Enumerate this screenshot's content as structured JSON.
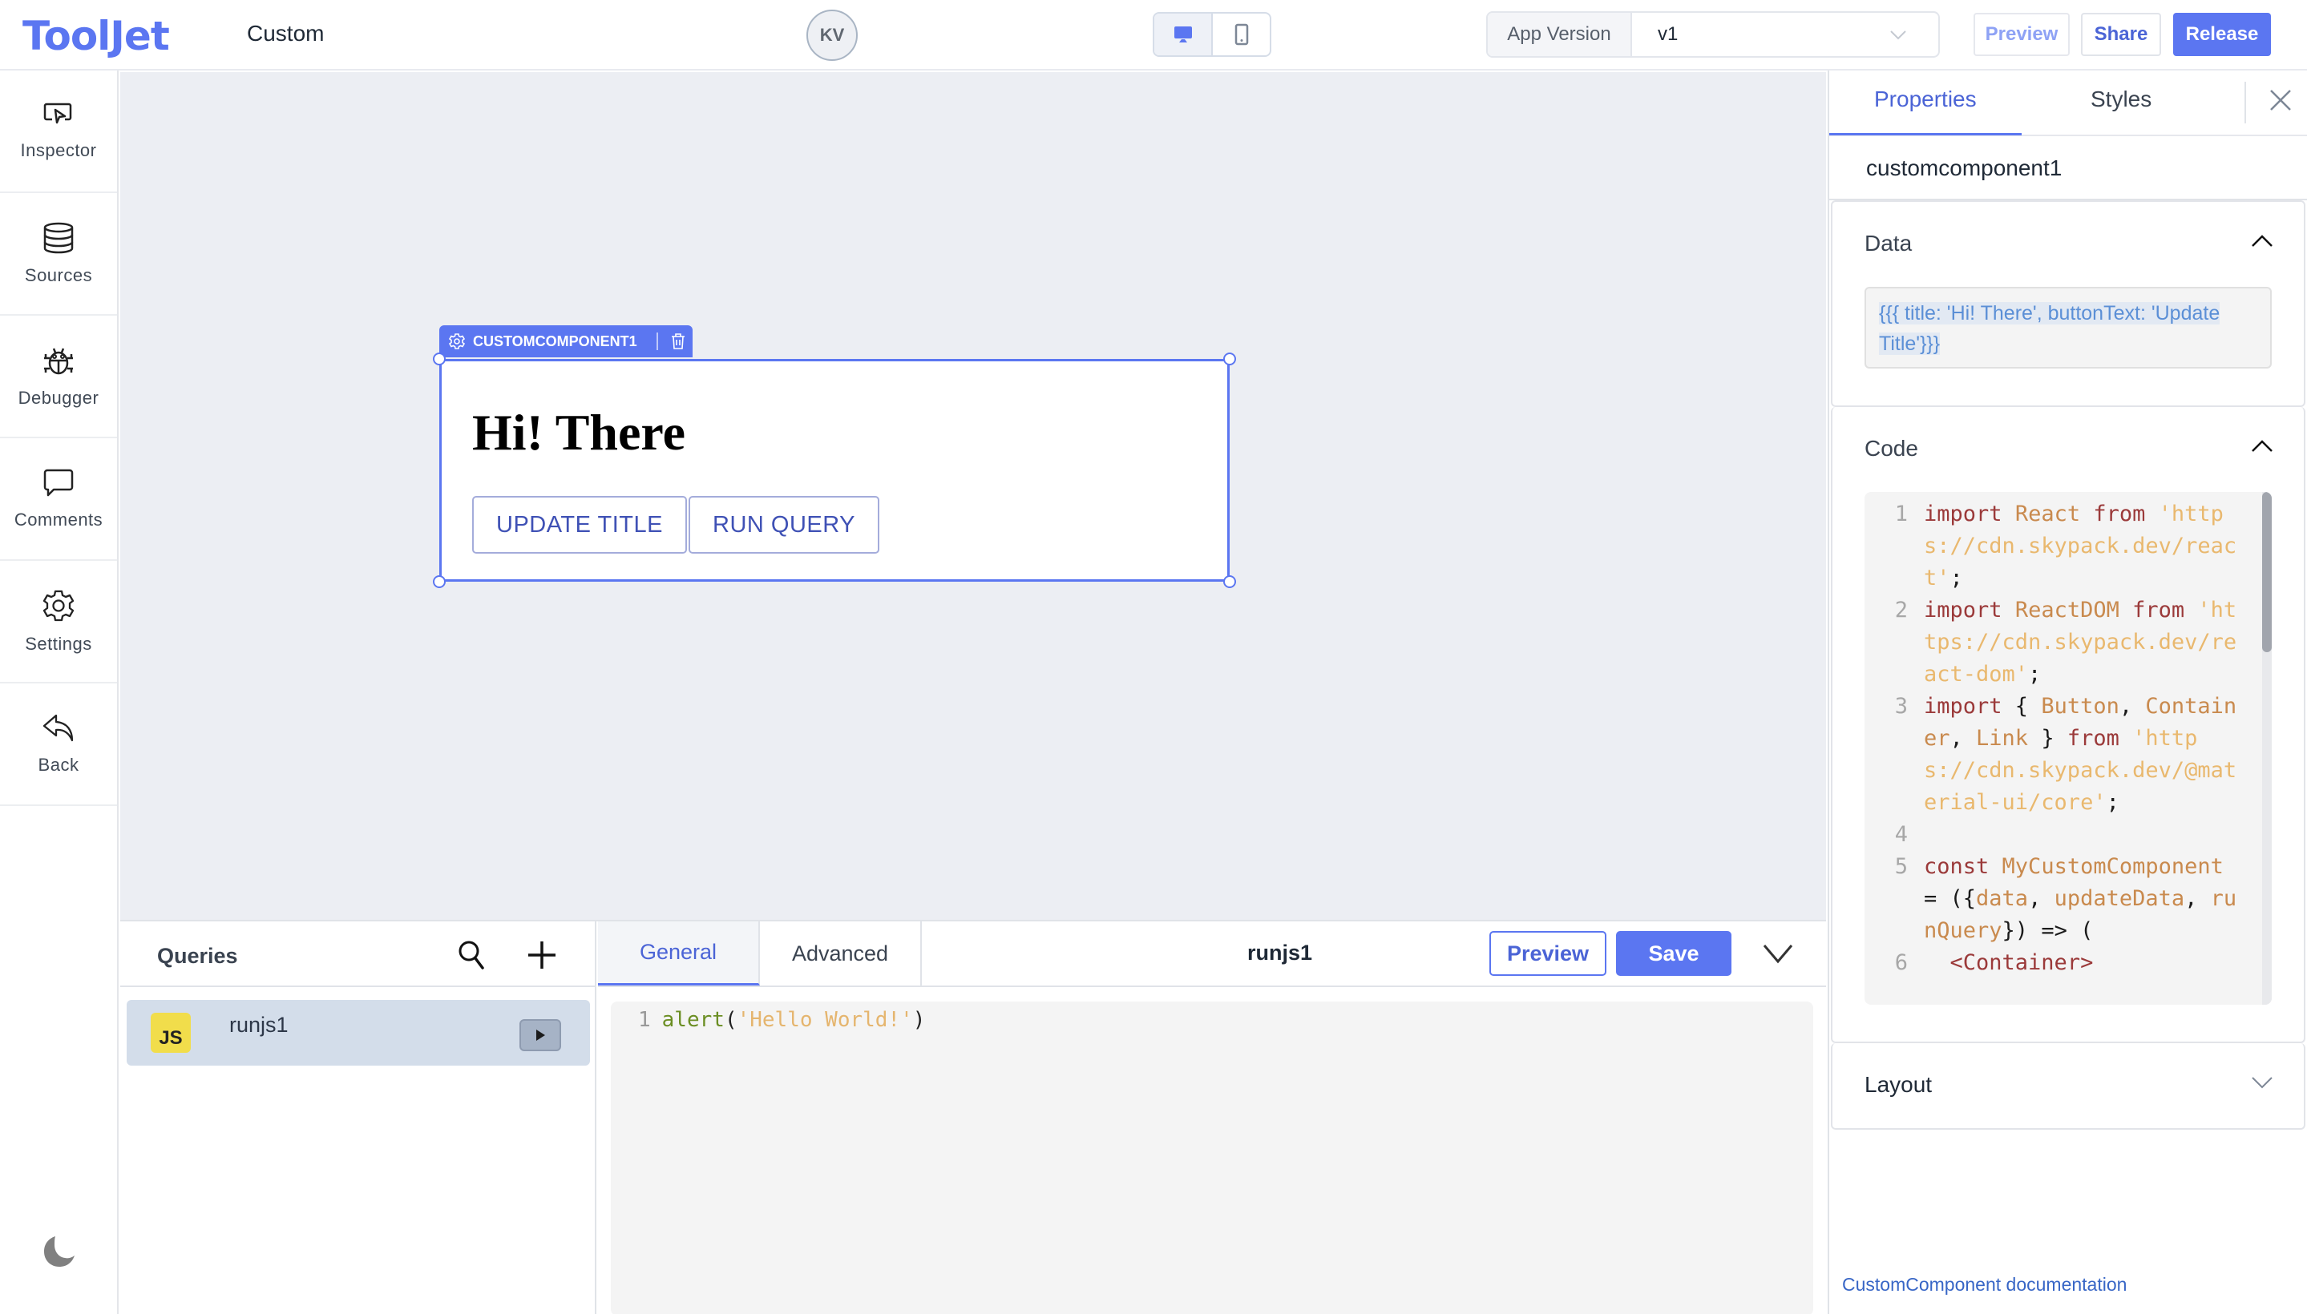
{
  "header": {
    "logo": "ToolJet",
    "app_name": "Custom",
    "avatar_initials": "KV",
    "device_toggle": {
      "active": "desktop",
      "options": [
        "desktop",
        "mobile"
      ]
    },
    "app_version_label": "App Version",
    "app_version_value": "v1",
    "preview_label": "Preview",
    "share_label": "Share",
    "release_label": "Release"
  },
  "sidebar": {
    "items": [
      {
        "label": "Inspector",
        "icon": "inspector-icon"
      },
      {
        "label": "Sources",
        "icon": "database-icon"
      },
      {
        "label": "Debugger",
        "icon": "bug-icon"
      },
      {
        "label": "Comments",
        "icon": "comment-icon"
      },
      {
        "label": "Settings",
        "icon": "gear-icon"
      },
      {
        "label": "Back",
        "icon": "back-arrow-icon"
      }
    ],
    "theme_toggle_icon": "moon-icon"
  },
  "canvas": {
    "component_tag": "CUSTOMCOMPONENT1",
    "component": {
      "title": "Hi! There",
      "buttons": [
        "UPDATE TITLE",
        "RUN QUERY"
      ]
    }
  },
  "queries": {
    "title": "Queries",
    "items": [
      {
        "name": "runjs1",
        "type": "JS"
      }
    ],
    "editor": {
      "tabs": [
        "General",
        "Advanced"
      ],
      "active_tab": "General",
      "query_name": "runjs1",
      "preview_label": "Preview",
      "save_label": "Save",
      "code": {
        "line": "1",
        "fn": "alert",
        "open": "(",
        "str": "'Hello World!'",
        "close": ")"
      }
    }
  },
  "inspector": {
    "tabs": [
      "Properties",
      "Styles"
    ],
    "active_tab": "Properties",
    "component_name": "customcomponent1",
    "sections": {
      "data": {
        "title": "Data",
        "value": "{{{ title: 'Hi! There', buttonText: 'Update Title'}}}"
      },
      "code": {
        "title": "Code",
        "lines": [
          {
            "n": "1",
            "tokens": [
              [
                "kw",
                "import"
              ],
              [
                "p",
                " "
              ],
              [
                "id",
                "React"
              ],
              [
                "p",
                " "
              ],
              [
                "kw",
                "from"
              ],
              [
                "p",
                " "
              ],
              [
                "str",
                "'https://cdn.skypack.dev/react'"
              ],
              [
                "p",
                ";"
              ]
            ]
          },
          {
            "n": "2",
            "tokens": [
              [
                "kw",
                "import"
              ],
              [
                "p",
                " "
              ],
              [
                "id",
                "ReactDOM"
              ],
              [
                "p",
                " "
              ],
              [
                "kw",
                "from"
              ],
              [
                "p",
                " "
              ],
              [
                "str",
                "'https://cdn.skypack.dev/react-dom'"
              ],
              [
                "p",
                ";"
              ]
            ]
          },
          {
            "n": "3",
            "tokens": [
              [
                "kw",
                "import"
              ],
              [
                "p",
                " { "
              ],
              [
                "id",
                "Button"
              ],
              [
                "p",
                ", "
              ],
              [
                "id",
                "Container"
              ],
              [
                "p",
                ", "
              ],
              [
                "id",
                "Link"
              ],
              [
                "p",
                " } "
              ],
              [
                "kw",
                "from"
              ],
              [
                "p",
                " "
              ],
              [
                "str",
                "'https://cdn.skypack.dev/@material-ui/core'"
              ],
              [
                "p",
                ";"
              ]
            ]
          },
          {
            "n": "4",
            "tokens": []
          },
          {
            "n": "5",
            "tokens": [
              [
                "kw",
                "const"
              ],
              [
                "p",
                " "
              ],
              [
                "id",
                "MyCustomComponent"
              ],
              [
                "p",
                " = ({"
              ],
              [
                "id",
                "data"
              ],
              [
                "p",
                ", "
              ],
              [
                "id",
                "updateData"
              ],
              [
                "p",
                ", "
              ],
              [
                "id",
                "runQuery"
              ],
              [
                "p",
                "}) => ("
              ]
            ]
          },
          {
            "n": "6",
            "tokens": [
              [
                "p",
                "  "
              ],
              [
                "kw",
                "<Container>"
              ]
            ]
          }
        ]
      },
      "layout": {
        "title": "Layout"
      }
    },
    "doc_link": "CustomComponent documentation"
  }
}
